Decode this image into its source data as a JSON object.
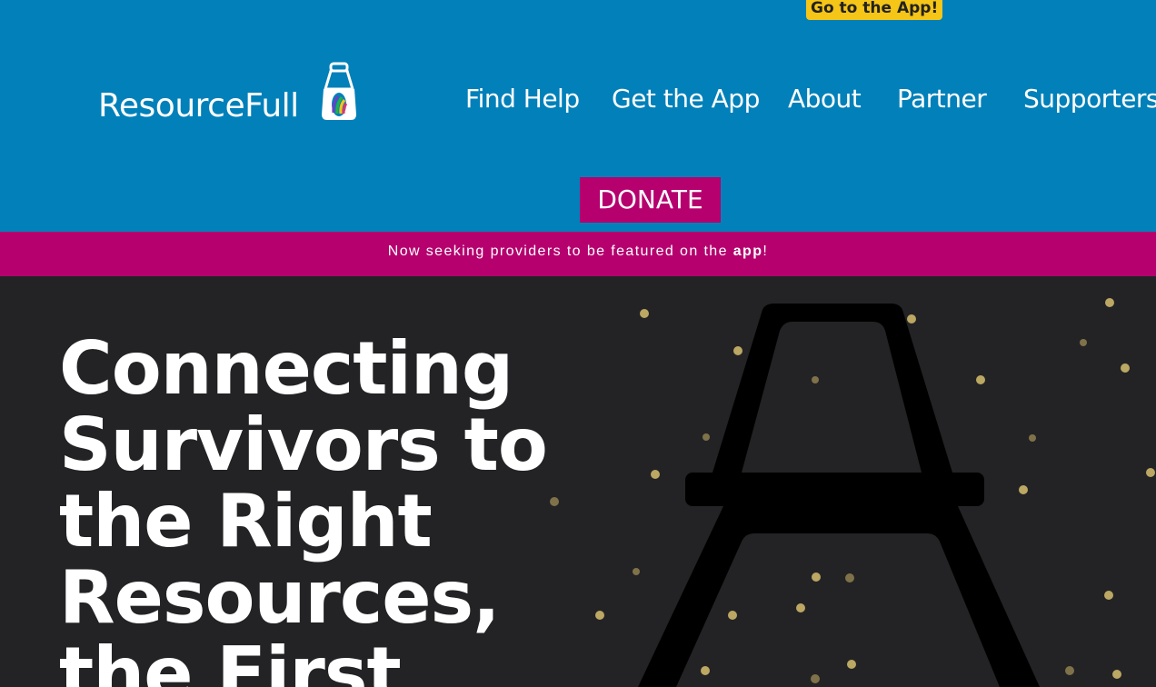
{
  "header": {
    "cta_label": "Go to the App!",
    "logo_text": "ResourceFull",
    "nav": [
      "Find Help",
      "Get the App",
      "About",
      "Partner",
      "Supporters"
    ],
    "donate_label": "DONATE"
  },
  "banner": {
    "text_before": "Now seeking providers to be featured on the ",
    "link_text": "app",
    "text_after": "!"
  },
  "hero": {
    "title": "Connecting Survivors to the Right Resources, the First"
  },
  "colors": {
    "header_bg": "#0180b9",
    "accent_magenta": "#b5006e",
    "cta_yellow": "#f5c518",
    "hero_bg": "#232325"
  }
}
